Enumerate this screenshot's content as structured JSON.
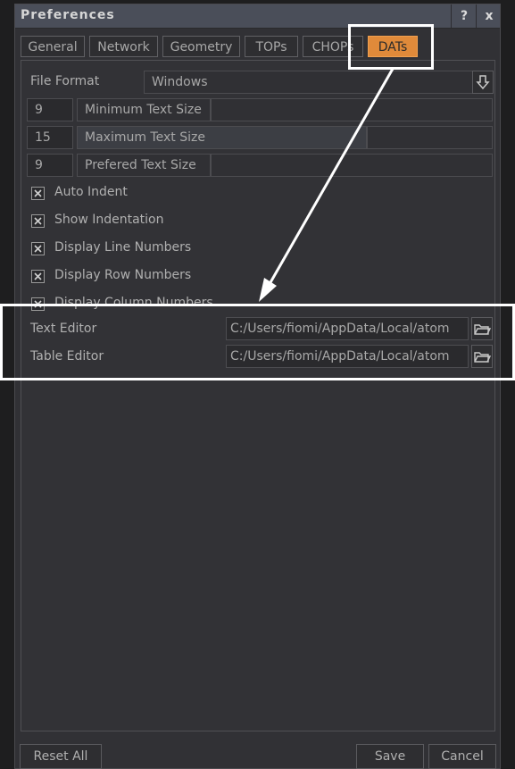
{
  "window": {
    "title": "Preferences",
    "help_label": "?",
    "close_label": "x"
  },
  "tabs": [
    {
      "label": "General"
    },
    {
      "label": "Network"
    },
    {
      "label": "Geometry"
    },
    {
      "label": "TOPs"
    },
    {
      "label": "CHOPs"
    },
    {
      "label": "DATs"
    }
  ],
  "active_tab": "DATs",
  "dats": {
    "file_format": {
      "label": "File Format",
      "value": "Windows"
    },
    "min_text_size": {
      "value": "9",
      "label": "Minimum Text Size"
    },
    "max_text_size": {
      "value": "15",
      "label": "Maximum Text Size"
    },
    "pref_text_size": {
      "value": "9",
      "label": "Prefered Text Size"
    },
    "checkboxes": [
      {
        "label": "Auto Indent",
        "checked": true
      },
      {
        "label": "Show Indentation",
        "checked": true
      },
      {
        "label": "Display Line Numbers",
        "checked": true
      },
      {
        "label": "Display Row Numbers",
        "checked": true
      },
      {
        "label": "Display Column Numbers",
        "checked": true
      }
    ],
    "text_editor": {
      "label": "Text Editor",
      "value": "C:/Users/fiomi/AppData/Local/atom"
    },
    "table_editor": {
      "label": "Table Editor",
      "value": "C:/Users/fiomi/AppData/Local/atom"
    }
  },
  "footer": {
    "reset_label": "Reset All",
    "save_label": "Save",
    "cancel_label": "Cancel"
  },
  "colors": {
    "accent": "#e08a3a",
    "annotation": "#ffffff",
    "panel_bg": "#313135"
  }
}
